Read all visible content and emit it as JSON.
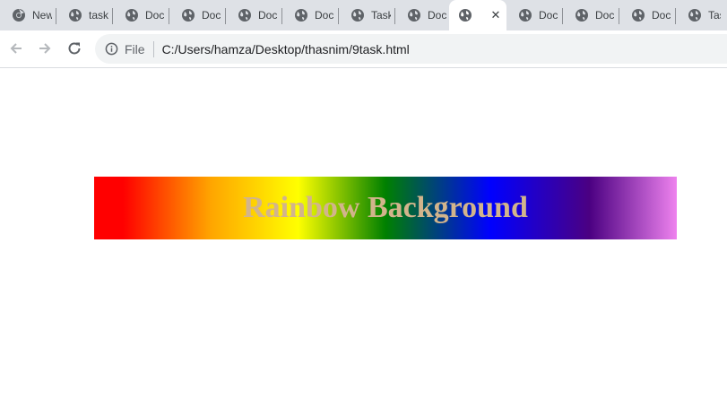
{
  "browser": {
    "tabs": [
      {
        "label": "New",
        "icon": "chrome-icon",
        "active": false
      },
      {
        "label": "task",
        "icon": "globe-icon",
        "active": false
      },
      {
        "label": "Doc",
        "icon": "globe-icon",
        "active": false
      },
      {
        "label": "Doc",
        "icon": "globe-icon",
        "active": false
      },
      {
        "label": "Doc",
        "icon": "globe-icon",
        "active": false
      },
      {
        "label": "Doc",
        "icon": "globe-icon",
        "active": false
      },
      {
        "label": "Task",
        "icon": "globe-icon",
        "active": false
      },
      {
        "label": "Doc",
        "icon": "globe-icon",
        "active": false
      },
      {
        "label": "",
        "icon": "globe-icon",
        "active": true,
        "close": "✕"
      },
      {
        "label": "Doc",
        "icon": "globe-icon",
        "active": false
      },
      {
        "label": "Doc",
        "icon": "globe-icon",
        "active": false
      },
      {
        "label": "Doc",
        "icon": "globe-icon",
        "active": false
      },
      {
        "label": "Task",
        "icon": "globe-icon",
        "active": false
      }
    ],
    "toolbar": {
      "back_icon": "arrow-left-icon",
      "forward_icon": "arrow-right-icon",
      "reload_icon": "reload-icon"
    },
    "address_bar": {
      "info_icon": "info-icon",
      "scheme": "File",
      "url": "C:/Users/hamza/Desktop/thasnim/9task.html"
    }
  },
  "page": {
    "heading": "Rainbow Background",
    "colors": {
      "gradient": [
        "#ff0000",
        "#ffa500",
        "#ffff00",
        "#008000",
        "#0000ff",
        "#4b0082",
        "#ee82ee"
      ],
      "heading_color": "#d2b48c"
    }
  }
}
